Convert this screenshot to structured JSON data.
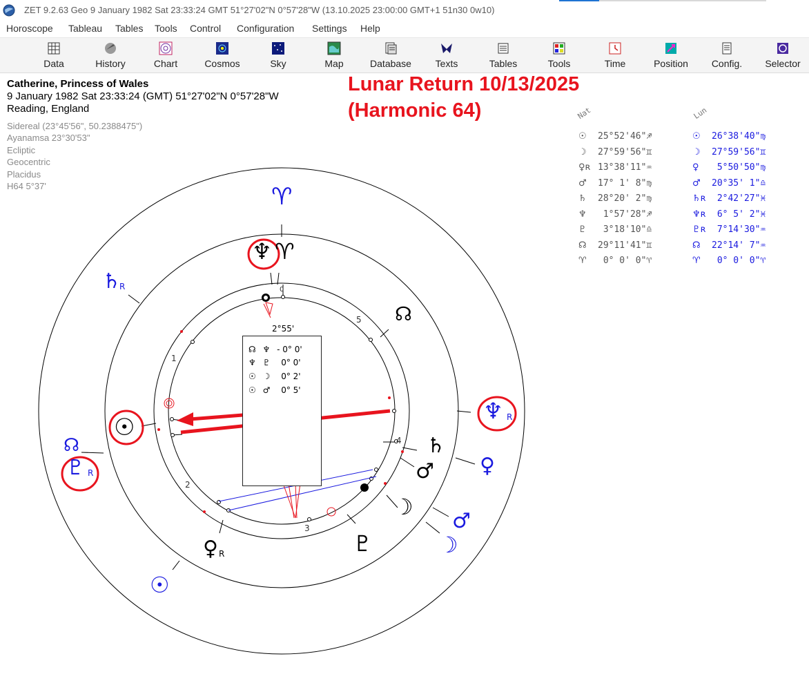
{
  "window": {
    "title": "ZET 9.2.63 Geo    9 January 1982  Sat  23:33:24 GMT 51°27'02\"N  0°57'28\"W  (13.10.2025  23:00:00 GMT+1 51n30 0w10)"
  },
  "menu": [
    "Horoscope",
    "Tableau",
    "Tables",
    "Tools",
    "Control",
    "Configuration",
    "Settings",
    "Help"
  ],
  "toolbar": [
    "Data",
    "History",
    "Chart",
    "Cosmos",
    "Sky",
    "Map",
    "Database",
    "Texts",
    "Tables",
    "Tools",
    "Time",
    "Position",
    "Config.",
    "Selector"
  ],
  "info": {
    "name": "Catherine, Princess of Wales",
    "datetime": "9 January 1982  Sat  23:33:24 (GMT) 51°27'02\"N  0°57'28\"W",
    "place": "Reading, England",
    "settings": [
      "Sidereal (23°45'56\", 50.2388475\")",
      "Ayanamsa 23°30'53\"",
      "Ecliptic",
      "Geocentric",
      "Placidus",
      "H64   5°37'"
    ]
  },
  "headline": {
    "line1": "Lunar Return 10/13/2025",
    "line2": "(Harmonic 64)"
  },
  "positions": {
    "nat_header": "Nat",
    "lun_header": "Lun",
    "natal": [
      {
        "glyph": "☉",
        "text": "25°52'46\"♐"
      },
      {
        "glyph": "☽",
        "text": "27°59'56\"♊"
      },
      {
        "glyph": "♀ʀ",
        "text": "13°38'11\"♒"
      },
      {
        "glyph": "♂",
        "text": "17° 1' 8\"♍"
      },
      {
        "glyph": "♄",
        "text": "28°20' 2\"♍"
      },
      {
        "glyph": "♆",
        "text": " 1°57'28\"♐"
      },
      {
        "glyph": "♇",
        "text": " 3°18'10\"♎"
      },
      {
        "glyph": "☊",
        "text": "29°11'41\"♊"
      },
      {
        "glyph": "♈",
        "text": " 0° 0' 0\"♈"
      }
    ],
    "lunar": [
      {
        "glyph": "☉",
        "text": "26°38'40\"♍"
      },
      {
        "glyph": "☽",
        "text": "27°59'56\"♊"
      },
      {
        "glyph": "♀",
        "text": " 5°50'50\"♍"
      },
      {
        "glyph": "♂",
        "text": "20°35' 1\"♎"
      },
      {
        "glyph": "♄ʀ",
        "text": " 2°42'27\"♓"
      },
      {
        "glyph": "♆ʀ",
        "text": " 6° 5' 2\"♓"
      },
      {
        "glyph": "♇ʀ",
        "text": " 7°14'30\"♒"
      },
      {
        "glyph": "☊",
        "text": "22°14' 7\"♒"
      },
      {
        "glyph": "♈",
        "text": " 0° 0' 0\"♈"
      }
    ]
  },
  "chart": {
    "orb_label": "2°55'",
    "house_numbers": [
      "0",
      "5",
      "1",
      "4",
      "2",
      "3"
    ],
    "aspects": [
      {
        "p1": "☊",
        "p2": "♆",
        "orb": "- 0° 0'"
      },
      {
        "p1": "♆",
        "p2": "♇",
        "orb": "0° 0'"
      },
      {
        "p1": "☉",
        "p2": "☽",
        "orb": "0° 2'"
      },
      {
        "p1": "☉",
        "p2": "♂",
        "orb": "0° 5'"
      }
    ],
    "glyphs": {
      "aries_outer": "♈",
      "neptune_natal": "♆",
      "aries_inner": "♈",
      "node": "☊",
      "sun_natal": "☉",
      "node_lunar": "☊",
      "pluto_lunar": "♇",
      "retro": "R",
      "saturn_lunar": "♄",
      "neptune_lunar": "♆",
      "saturn_natal": "♄",
      "mars_natal": "♂",
      "venus_lunar": "♀",
      "moon_natal": "☽",
      "mars_lunar": "♂",
      "moon_lunar": "☽",
      "pluto_natal": "♇",
      "venus_natal": "♀",
      "sun_lunar": "☉"
    }
  },
  "colors": {
    "highlight": "#e8141e",
    "lunar": "#1a1adf",
    "natal": "#000000"
  }
}
